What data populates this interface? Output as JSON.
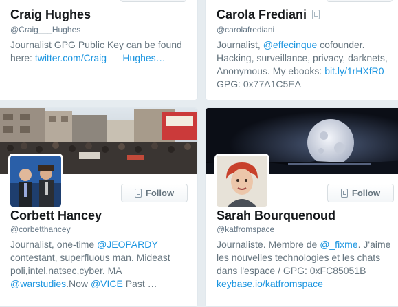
{
  "cards": [
    {
      "name": "Craig Hughes",
      "handle": "@Craig___Hughes",
      "bio_text": "Journalist GPG Public Key can be found here: ",
      "bio_link": "twitter.com/Craig___Hughes…"
    },
    {
      "name": "Carola Frediani",
      "handle": "@carolafrediani",
      "bio_pre": "Journalist, ",
      "bio_mention": "@effecinque",
      "bio_mid": " cofounder. Hacking, surveillance, privacy, darknets, Anonymous. My ebooks: ",
      "bio_link": "bit.ly/1rHXfR0",
      "bio_post": " GPG: 0x77A1C5EA"
    },
    {
      "name": "Corbett Hancey",
      "handle": "@corbetthancey",
      "follow_label": "Follow",
      "bio_pre": "Journalist, one-time ",
      "bio_mention1": "@JEOPARDY",
      "bio_mid": " contestant, superfluous man. Mideast poli,intel,natsec,cyber. MA ",
      "bio_mention2": "@warstudies",
      "bio_mid2": ".Now ",
      "bio_mention3": "@VICE",
      "bio_post": " Past …"
    },
    {
      "name": "Sarah Bourquenoud",
      "handle": "@katfromspace",
      "follow_label": "Follow",
      "bio_pre": "Journaliste. Membre de ",
      "bio_mention": "@_fixme",
      "bio_mid": ". J'aime les nouvelles technologies et les chats dans l'espace / GPG: 0xFC85051B ",
      "bio_link": "keybase.io/katfromspace"
    }
  ],
  "colors": {
    "link": "#1b95e0",
    "name": "#14171a",
    "muted": "#66757f",
    "background": "#e6ecf0"
  },
  "icons": [
    "follow-user-icon",
    "verified-account-icon"
  ]
}
